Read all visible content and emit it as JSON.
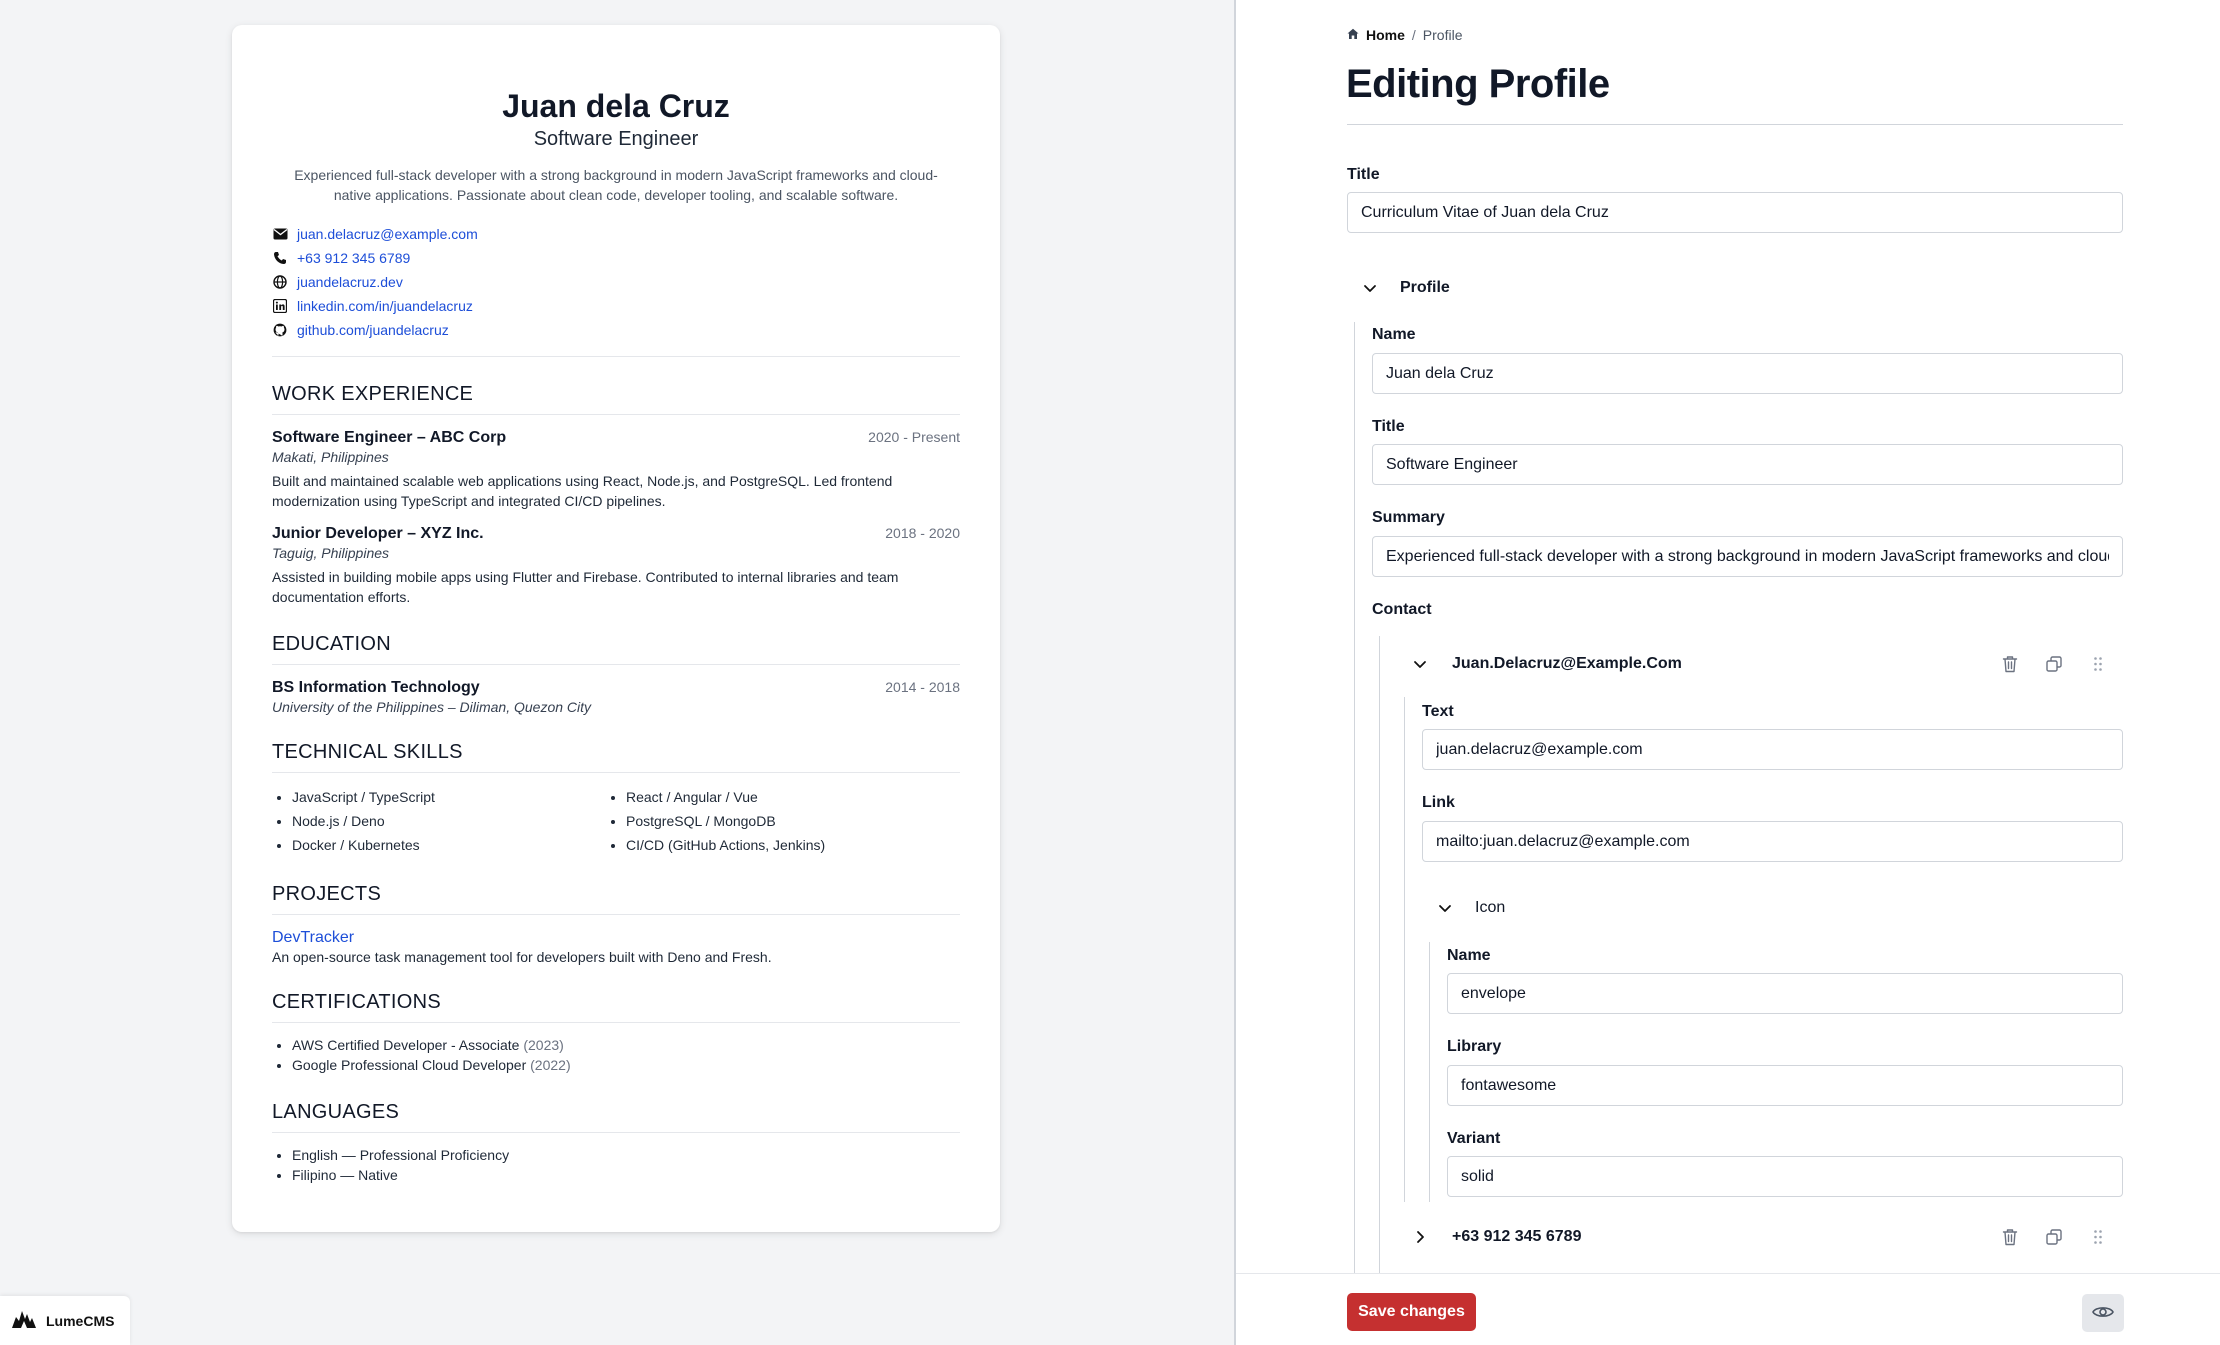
{
  "preview": {
    "name": "Juan dela Cruz",
    "role": "Software Engineer",
    "summary": "Experienced full-stack developer with a strong background in modern JavaScript frameworks and cloud-native applications. Passionate about clean code, developer tooling, and scalable software.",
    "contacts": [
      {
        "icon": "envelope-icon",
        "text": "juan.delacruz@example.com"
      },
      {
        "icon": "phone-icon",
        "text": "+63 912 345 6789"
      },
      {
        "icon": "globe-icon",
        "text": "juandelacruz.dev"
      },
      {
        "icon": "linkedin-icon",
        "text": "linkedin.com/in/juandelacruz"
      },
      {
        "icon": "github-icon",
        "text": "github.com/juandelacruz"
      }
    ],
    "work_heading": "WORK EXPERIENCE",
    "jobs": [
      {
        "title": "Software Engineer – ABC Corp",
        "date": "2020 - Present",
        "location": "Makati, Philippines",
        "desc": "Built and maintained scalable web applications using React, Node.js, and PostgreSQL. Led frontend modernization using TypeScript and integrated CI/CD pipelines."
      },
      {
        "title": "Junior Developer – XYZ Inc.",
        "date": "2018 - 2020",
        "location": "Taguig, Philippines",
        "desc": "Assisted in building mobile apps using Flutter and Firebase. Contributed to internal libraries and team documentation efforts."
      }
    ],
    "education_heading": "EDUCATION",
    "education": {
      "degree": "BS Information Technology",
      "date": "2014 - 2018",
      "school": "University of the Philippines – Diliman, Quezon City"
    },
    "skills_heading": "TECHNICAL SKILLS",
    "skills": [
      "JavaScript / TypeScript",
      "React / Angular / Vue",
      "Node.js / Deno",
      "PostgreSQL / MongoDB",
      "Docker / Kubernetes",
      "CI/CD (GitHub Actions, Jenkins)"
    ],
    "projects_heading": "PROJECTS",
    "project": {
      "name": "DevTracker",
      "desc": "An open-source task management tool for developers built with Deno and Fresh."
    },
    "certs_heading": "CERTIFICATIONS",
    "certs": [
      {
        "name": "AWS Certified Developer - Associate",
        "year": "(2023)"
      },
      {
        "name": "Google Professional Cloud Developer",
        "year": "(2022)"
      }
    ],
    "languages_heading": "LANGUAGES",
    "languages": [
      "English — Professional Proficiency",
      "Filipino — Native"
    ]
  },
  "brand": {
    "name": "LumeCMS"
  },
  "editor": {
    "breadcrumb": {
      "home": "Home",
      "separator": "/",
      "current": "Profile"
    },
    "page_title": "Editing Profile",
    "title_field": {
      "label": "Title",
      "value": "Curriculum Vitae of Juan dela Cruz"
    },
    "profile_group": {
      "label": "Profile",
      "name": {
        "label": "Name",
        "value": "Juan dela Cruz"
      },
      "title": {
        "label": "Title",
        "value": "Software Engineer"
      },
      "summary": {
        "label": "Summary",
        "value": "Experienced full-stack developer with a strong background in modern JavaScript frameworks and cloud-native applications. Passionate about clean code, developer tooling, and scalable software."
      },
      "contact_label": "Contact",
      "contact_items": [
        {
          "heading": "Juan.Delacruz@Example.Com",
          "expanded": true,
          "text": {
            "label": "Text",
            "value": "juan.delacruz@example.com"
          },
          "link": {
            "label": "Link",
            "value": "mailto:juan.delacruz@example.com"
          },
          "icon_group": {
            "label": "Icon",
            "name": {
              "label": "Name",
              "value": "envelope"
            },
            "library": {
              "label": "Library",
              "value": "fontawesome"
            },
            "variant": {
              "label": "Variant",
              "value": "solid"
            }
          }
        },
        {
          "heading": "+63 912 345 6789",
          "expanded": false
        }
      ]
    },
    "save_label": "Save changes"
  },
  "colors": {
    "accent": "#c53030",
    "link": "#1d4ed8",
    "border": "#d1d5db"
  }
}
